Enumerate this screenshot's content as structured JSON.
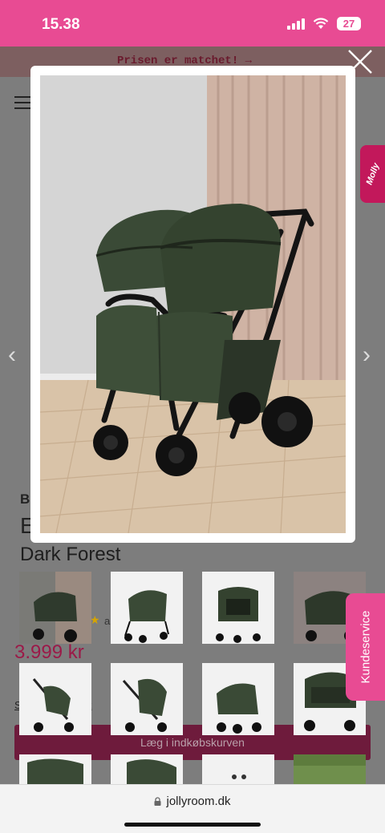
{
  "status_bar": {
    "time": "15.38",
    "battery": "27"
  },
  "page": {
    "promo": "Prisen er matchet! →",
    "brand_initial": "B",
    "title_initial": "E",
    "variant": "Dark Forest",
    "rating_fragment": "anm",
    "price": "3.999 kr",
    "link_fragment_left": "S",
    "link_fragment_right": "k",
    "add_to_cart": "Læg i indkøbskurven"
  },
  "side_tabs": {
    "molly": "Molly",
    "customer_service": "Kundeservice"
  },
  "browser": {
    "url": "jollyroom.dk"
  },
  "icons": {
    "close": "close-icon",
    "lock": "lock-icon",
    "menu": "hamburger-menu-icon",
    "prev": "chevron-left-icon",
    "next": "chevron-right-icon"
  },
  "colors": {
    "brand_pink": "#e84b93",
    "brand_magenta": "#c2185b",
    "stroller_green": "#3a4a36",
    "cart_button": "#6e1b3c",
    "price": "#9b1a48"
  }
}
